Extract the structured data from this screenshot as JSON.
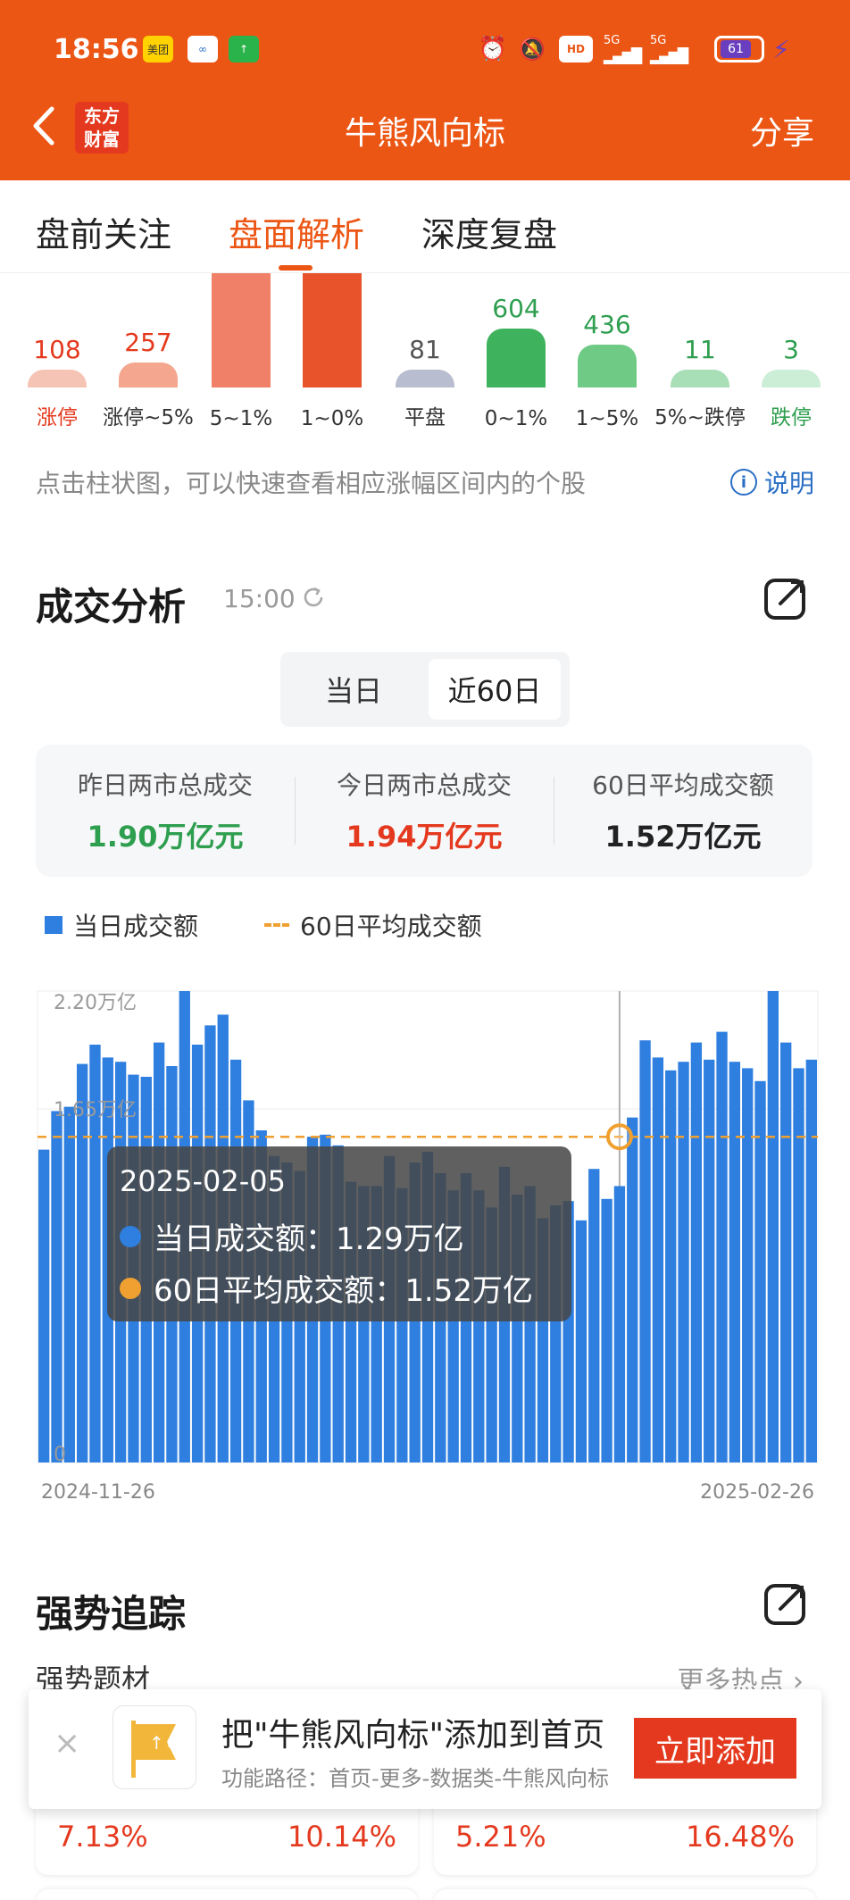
{
  "status_bar": {
    "time": "18:56",
    "apps": [
      "美团",
      "",
      ""
    ],
    "network": [
      "HD",
      "5G",
      "5G"
    ],
    "battery": "61"
  },
  "nav": {
    "title": "牛熊风向标",
    "share": "分享",
    "logo_line1": "东方",
    "logo_line2": "财富"
  },
  "tabs": [
    "盘前关注",
    "盘面解析",
    "深度复盘"
  ],
  "active_tab": 1,
  "distribution": {
    "bars": [
      {
        "value": "108",
        "label": "涨停",
        "h": 20,
        "color": "#f6c4b4",
        "text": "#e4391e",
        "label_color": "#e4391e"
      },
      {
        "value": "257",
        "label": "涨停~5%",
        "h": 28,
        "color": "#f4a78e",
        "text": "#e4391e",
        "label_color": "#333333"
      },
      {
        "value": "",
        "label": "5~1%",
        "h": 140,
        "color": "#f08068",
        "text": "#e4391e",
        "label_color": "#333333"
      },
      {
        "value": "",
        "label": "1~0%",
        "h": 140,
        "color": "#e9532c",
        "text": "#e4391e",
        "label_color": "#333333"
      },
      {
        "value": "81",
        "label": "平盘",
        "h": 20,
        "color": "#b9bdd0",
        "text": "#555555",
        "label_color": "#333333"
      },
      {
        "value": "604",
        "label": "0~1%",
        "h": 66,
        "color": "#3fb25e",
        "text": "#2e9e4f",
        "label_color": "#333333"
      },
      {
        "value": "436",
        "label": "1~5%",
        "h": 48,
        "color": "#6fca86",
        "text": "#2e9e4f",
        "label_color": "#333333"
      },
      {
        "value": "11",
        "label": "5%~跌停",
        "h": 20,
        "color": "#a9dfb7",
        "text": "#2e9e4f",
        "label_color": "#333333"
      },
      {
        "value": "3",
        "label": "跌停",
        "h": 20,
        "color": "#cdeed6",
        "text": "#2e9e4f",
        "label_color": "#2e9e4f"
      }
    ],
    "note": "点击柱状图，可以快速查看相应涨幅区间内的个股",
    "help": "说明"
  },
  "turnover": {
    "title": "成交分析",
    "time": "15:00",
    "segments": [
      "当日",
      "近60日"
    ],
    "active_segment": 1,
    "stats": [
      {
        "label": "昨日两市总成交",
        "value": "1.90万亿元",
        "color": "#2e9e4f"
      },
      {
        "label": "今日两市总成交",
        "value": "1.94万亿元",
        "color": "#e4391e"
      },
      {
        "label": "60日平均成交额",
        "value": "1.52万亿元",
        "color": "#222222"
      }
    ],
    "legend": {
      "bar": "当日成交额",
      "line": "60日平均成交额"
    },
    "tooltip": {
      "date": "2025-02-05",
      "bar_line": "当日成交额：1.29万亿",
      "avg_line": "60日平均成交额：1.52万亿"
    }
  },
  "chart_data": {
    "type": "bar",
    "x_start": "2024-11-26",
    "x_end": "2025-02-26",
    "y_tick_labels": [
      "2.20万亿",
      "1.65万亿",
      "0"
    ],
    "ylim": [
      0,
      2.2
    ],
    "average": 1.52,
    "highlight_index": 45,
    "values": [
      1.46,
      1.64,
      1.66,
      1.86,
      1.95,
      1.89,
      1.87,
      1.81,
      1.8,
      1.96,
      1.85,
      2.2,
      1.95,
      2.04,
      2.09,
      1.88,
      1.69,
      1.55,
      1.43,
      1.4,
      1.36,
      1.52,
      1.53,
      1.48,
      1.31,
      1.29,
      1.29,
      1.43,
      1.28,
      1.4,
      1.45,
      1.35,
      1.27,
      1.35,
      1.27,
      1.19,
      1.38,
      1.25,
      1.29,
      1.14,
      1.2,
      1.22,
      1.13,
      1.37,
      1.23,
      1.29,
      1.61,
      1.97,
      1.89,
      1.83,
      1.87,
      1.96,
      1.88,
      2.01,
      1.87,
      1.84,
      1.78,
      2.2,
      1.96,
      1.84,
      1.88
    ]
  },
  "strength": {
    "title": "强势追踪",
    "subtitle": "强势题材",
    "more": "更多热点",
    "percents": [
      "7.13%",
      "10.14%",
      "5.21%",
      "16.48%"
    ]
  },
  "banner": {
    "title": "把\"牛熊风向标\"添加到首页",
    "path": "功能路径：首页-更多-数据类-牛熊风向标",
    "button": "立即添加",
    "close": "×"
  },
  "colors": {
    "brand": "#ec5614",
    "red": "#e4391e",
    "green": "#2e9e4f",
    "bar_blue": "#2f7fe0",
    "avg_line": "#f0a030"
  }
}
